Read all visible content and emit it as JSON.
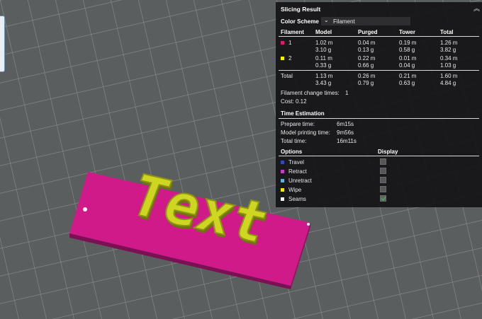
{
  "panel": {
    "title": "Slicing Result",
    "color_scheme_label": "Color Scheme",
    "color_scheme_value": "Filament",
    "headers": [
      "Filament",
      "Model",
      "Purged",
      "Tower",
      "Total"
    ],
    "rows": [
      {
        "id": "1",
        "color": "#e5196f",
        "model": [
          "1.02 m",
          "3.10 g"
        ],
        "purged": [
          "0.04 m",
          "0.13 g"
        ],
        "tower": [
          "0.19 m",
          "0.58 g"
        ],
        "total": [
          "1.26 m",
          "3.82 g"
        ]
      },
      {
        "id": "2",
        "color": "#f2f202",
        "model": [
          "0.11 m",
          "0.33 g"
        ],
        "purged": [
          "0.22 m",
          "0.66 g"
        ],
        "tower": [
          "0.01 m",
          "0.04 g"
        ],
        "total": [
          "0.34 m",
          "1.03 g"
        ]
      }
    ],
    "total_row": {
      "label": "Total",
      "model": [
        "1.13 m",
        "3.43 g"
      ],
      "purged": [
        "0.26 m",
        "0.79 g"
      ],
      "tower": [
        "0.21 m",
        "0.63 g"
      ],
      "total": [
        "1.60 m",
        "4.84 g"
      ]
    },
    "filament_change_label": "Filament change times:",
    "filament_change_value": "1",
    "cost_label": "Cost:",
    "cost_value": "0.12",
    "time_title": "Time Estimation",
    "times": [
      {
        "label": "Prepare time:",
        "value": "6m15s"
      },
      {
        "label": "Model printing time:",
        "value": "9m56s"
      },
      {
        "label": "Total time:",
        "value": "16m11s"
      }
    ],
    "options_title": "Options",
    "display_title": "Display",
    "options": [
      {
        "label": "Travel",
        "color": "#3246c8",
        "checked": false
      },
      {
        "label": "Retract",
        "color": "#c83cc8",
        "checked": false
      },
      {
        "label": "Unretract",
        "color": "#5ab4dc",
        "checked": false
      },
      {
        "label": "Wipe",
        "color": "#f0e614",
        "checked": false
      },
      {
        "label": "Seams",
        "color": "#f0f0f0",
        "checked": true
      }
    ]
  },
  "model": {
    "text": "Text",
    "base_color": "#c5157f",
    "text_color": "#cdd420"
  }
}
